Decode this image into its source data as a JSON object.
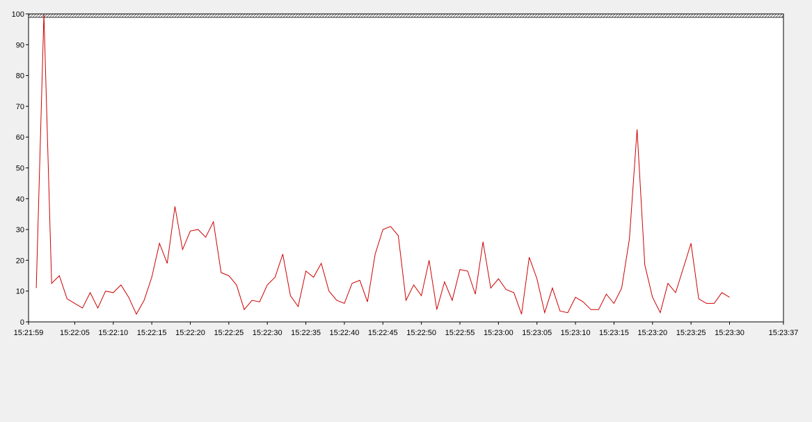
{
  "chart_data": {
    "type": "line",
    "title": "",
    "xlabel": "",
    "ylabel": "",
    "ylim": [
      0,
      100
    ],
    "yticks": [
      0,
      10,
      20,
      30,
      40,
      50,
      60,
      70,
      80,
      90,
      100
    ],
    "xlim": [
      "15:21:59",
      "15:23:37"
    ],
    "xtick_labels": [
      "15:21:59",
      "15:22:05",
      "15:22:10",
      "15:22:15",
      "15:22:20",
      "15:22:25",
      "15:22:30",
      "15:22:35",
      "15:22:40",
      "15:22:45",
      "15:22:50",
      "15:22:55",
      "15:23:00",
      "15:23:05",
      "15:23:10",
      "15:23:15",
      "15:23:20",
      "15:23:25",
      "15:23:30",
      "15:23:37"
    ],
    "grid": false,
    "legend": "none",
    "series": [
      {
        "color": "#cc0000",
        "x": [
          "15:22:00",
          "15:22:01",
          "15:22:02",
          "15:22:03",
          "15:22:04",
          "15:22:05",
          "15:22:06",
          "15:22:07",
          "15:22:08",
          "15:22:09",
          "15:22:10",
          "15:22:11",
          "15:22:12",
          "15:22:13",
          "15:22:14",
          "15:22:15",
          "15:22:16",
          "15:22:17",
          "15:22:18",
          "15:22:19",
          "15:22:20",
          "15:22:21",
          "15:22:22",
          "15:22:23",
          "15:22:24",
          "15:22:25",
          "15:22:26",
          "15:22:27",
          "15:22:28",
          "15:22:29",
          "15:22:30",
          "15:22:31",
          "15:22:32",
          "15:22:33",
          "15:22:34",
          "15:22:35",
          "15:22:36",
          "15:22:37",
          "15:22:38",
          "15:22:39",
          "15:22:40",
          "15:22:41",
          "15:22:42",
          "15:22:43",
          "15:22:44",
          "15:22:45",
          "15:22:46",
          "15:22:47",
          "15:22:48",
          "15:22:49",
          "15:22:50",
          "15:22:51",
          "15:22:52",
          "15:22:53",
          "15:22:54",
          "15:22:55",
          "15:22:56",
          "15:22:57",
          "15:22:58",
          "15:22:59",
          "15:23:00",
          "15:23:01",
          "15:23:02",
          "15:23:03",
          "15:23:04",
          "15:23:05",
          "15:23:06",
          "15:23:07",
          "15:23:08",
          "15:23:09",
          "15:23:10",
          "15:23:11",
          "15:23:12",
          "15:23:13",
          "15:23:14",
          "15:23:15",
          "15:23:16",
          "15:23:17",
          "15:23:18",
          "15:23:19",
          "15:23:20",
          "15:23:21",
          "15:23:22",
          "15:23:23",
          "15:23:24",
          "15:23:25",
          "15:23:26",
          "15:23:27",
          "15:23:28",
          "15:23:29",
          "15:23:30"
        ],
        "values": [
          11,
          100,
          12.5,
          15,
          7.5,
          6,
          4.5,
          9.5,
          4.5,
          10,
          9.5,
          12,
          8,
          2.5,
          7,
          14.5,
          25.5,
          19,
          37.5,
          23.5,
          29.5,
          30,
          27.5,
          32.5,
          16,
          15,
          12,
          4,
          7,
          6.5,
          12,
          14.5,
          22,
          8.5,
          5,
          16.5,
          14.5,
          19,
          10,
          7,
          6,
          12.5,
          13.5,
          6.5,
          22,
          30,
          31,
          28,
          7,
          12,
          8.5,
          20,
          4,
          13,
          7,
          17,
          16.5,
          9,
          26,
          11,
          14,
          10.5,
          9.5,
          2.5,
          21,
          14,
          3,
          11,
          3.5,
          3,
          8,
          6.5,
          4,
          4,
          9,
          6,
          11,
          27,
          62.5,
          18.5,
          8,
          3,
          12.5,
          9.5,
          17.5,
          25.5,
          7.5,
          6,
          6,
          9.5,
          8
        ]
      }
    ]
  }
}
